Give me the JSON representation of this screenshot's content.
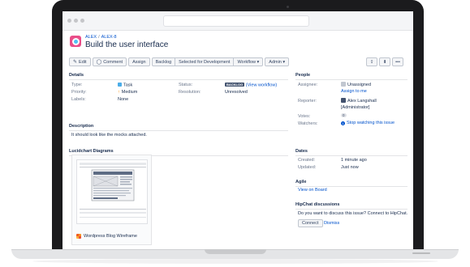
{
  "issue": {
    "project_key": "ALEX",
    "issue_key": "ALEX-8",
    "title": "Build the user interface"
  },
  "toolbar": {
    "edit": "Edit",
    "comment": "Comment",
    "assign": "Assign",
    "backlog": "Backlog",
    "selected": "Selected for Development",
    "workflow": "Workflow",
    "admin": "Admin",
    "more": "•••"
  },
  "details": {
    "heading": "Details",
    "type_label": "Type:",
    "type_value": "Task",
    "priority_label": "Priority:",
    "priority_value": "Medium",
    "labels_label": "Labels:",
    "labels_value": "None",
    "status_label": "Status:",
    "status_value": "BACKLOG",
    "view_workflow": "(View workflow)",
    "resolution_label": "Resolution:",
    "resolution_value": "Unresolved"
  },
  "description": {
    "heading": "Description",
    "text": "It should look like the mocks attached."
  },
  "lucidchart": {
    "heading": "Lucidchart Diagrams",
    "diagram_name": "Wordpress Blog Wireframe"
  },
  "people": {
    "heading": "People",
    "assignee_label": "Assignee:",
    "assignee_value": "Unassigned",
    "assign_to_me": "Assign to me",
    "reporter_label": "Reporter:",
    "reporter_name": "Alex Langshall",
    "reporter_role": "[Administrator]",
    "votes_label": "Votes:",
    "votes_value": "0",
    "watchers_label": "Watchers:",
    "watchers_count": "1",
    "stop_watching": "Stop watching this issue"
  },
  "dates": {
    "heading": "Dates",
    "created_label": "Created:",
    "created_value": "1 minute ago",
    "updated_label": "Updated:",
    "updated_value": "Just now"
  },
  "agile": {
    "heading": "Agile",
    "view_on_board": "View on Board"
  },
  "hipchat": {
    "heading": "HipChat discussions",
    "prompt": "Do you want to discuss this issue? Connect to HipChat.",
    "connect": "Connect",
    "dismiss": "Dismiss"
  },
  "colors": {
    "link": "#0052cc",
    "status_badge": "#42526e",
    "priority": "#ff8b00",
    "project_avatar": "#e94e89"
  },
  "icons": {
    "edit": "pencil-icon",
    "comment": "speech-bubble-icon",
    "share": "share-icon",
    "export": "export-icon"
  }
}
